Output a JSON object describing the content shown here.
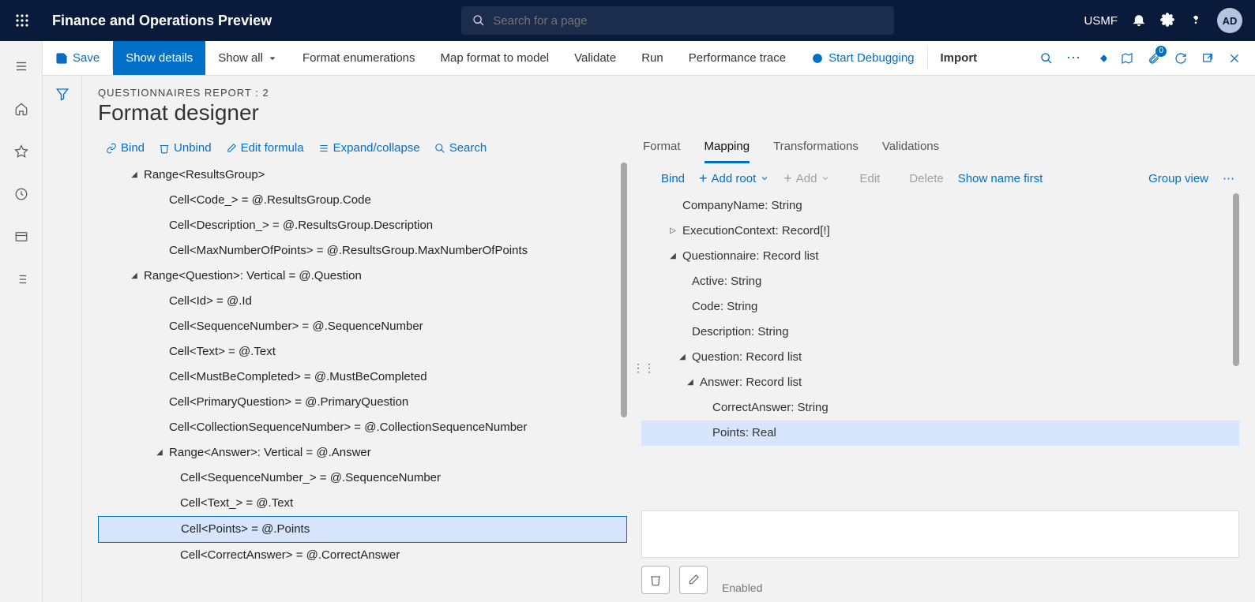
{
  "header": {
    "app_title": "Finance and Operations Preview",
    "search_placeholder": "Search for a page",
    "company": "USMF",
    "avatar": "AD"
  },
  "cmd": {
    "save": "Save",
    "show_details": "Show details",
    "show_all": "Show all",
    "format_enum": "Format enumerations",
    "map_format": "Map format to model",
    "validate": "Validate",
    "run": "Run",
    "perf_trace": "Performance trace",
    "start_debug": "Start Debugging",
    "import": "Import",
    "badge": "0"
  },
  "page": {
    "breadcrumb": "QUESTIONNAIRES REPORT : 2",
    "title": "Format designer"
  },
  "left_toolbar": {
    "bind": "Bind",
    "unbind": "Unbind",
    "edit_formula": "Edit formula",
    "expand": "Expand/collapse",
    "search": "Search"
  },
  "left_tree": [
    {
      "ind": 0,
      "tw": "▾",
      "text": "Range<ResultsGroup>"
    },
    {
      "ind": 1,
      "tw": "",
      "text": "Cell<Code_> = @.ResultsGroup.Code"
    },
    {
      "ind": 1,
      "tw": "",
      "text": "Cell<Description_> = @.ResultsGroup.Description"
    },
    {
      "ind": 1,
      "tw": "",
      "text": "Cell<MaxNumberOfPoints> = @.ResultsGroup.MaxNumberOfPoints"
    },
    {
      "ind": 0,
      "tw": "▾",
      "text": "Range<Question>: Vertical = @.Question"
    },
    {
      "ind": 1,
      "tw": "",
      "text": "Cell<Id> = @.Id"
    },
    {
      "ind": 1,
      "tw": "",
      "text": "Cell<SequenceNumber> = @.SequenceNumber"
    },
    {
      "ind": 1,
      "tw": "",
      "text": "Cell<Text> = @.Text"
    },
    {
      "ind": 1,
      "tw": "",
      "text": "Cell<MustBeCompleted> = @.MustBeCompleted"
    },
    {
      "ind": 1,
      "tw": "",
      "text": "Cell<PrimaryQuestion> = @.PrimaryQuestion"
    },
    {
      "ind": 1,
      "tw": "",
      "text": "Cell<CollectionSequenceNumber> = @.CollectionSequenceNumber"
    },
    {
      "ind": 1,
      "tw": "▾",
      "text": "Range<Answer>: Vertical = @.Answer"
    },
    {
      "ind": 2,
      "tw": "",
      "text": "Cell<SequenceNumber_> = @.SequenceNumber"
    },
    {
      "ind": 2,
      "tw": "",
      "text": "Cell<Text_> = @.Text"
    },
    {
      "ind": 2,
      "tw": "",
      "text": "Cell<Points> = @.Points",
      "selected": true
    },
    {
      "ind": 2,
      "tw": "",
      "text": "Cell<CorrectAnswer> = @.CorrectAnswer"
    }
  ],
  "tabs": {
    "format": "Format",
    "mapping": "Mapping",
    "transformations": "Transformations",
    "validations": "Validations"
  },
  "right_toolbar": {
    "bind": "Bind",
    "add_root": "Add root",
    "add": "Add",
    "edit": "Edit",
    "delete": "Delete",
    "show_name": "Show name first",
    "group_view": "Group view"
  },
  "map_tree": [
    {
      "ind": 0,
      "tw": "",
      "text": "CompanyName: String"
    },
    {
      "ind": 0,
      "tw": "▸",
      "text": "ExecutionContext: Record[!]"
    },
    {
      "ind": 0,
      "tw": "▾",
      "text": "Questionnaire: Record list"
    },
    {
      "ind": 1,
      "tw": "",
      "text": "Active: String"
    },
    {
      "ind": 1,
      "tw": "",
      "text": "Code: String"
    },
    {
      "ind": 1,
      "tw": "",
      "text": "Description: String"
    },
    {
      "ind": 1,
      "tw": "▾",
      "text": "Question: Record list"
    },
    {
      "ind": 2,
      "tw": "▾",
      "text": "Answer: Record list"
    },
    {
      "ind": 3,
      "tw": "",
      "text": "CorrectAnswer: String"
    },
    {
      "ind": 3,
      "tw": "",
      "text": "Points: Real",
      "highlight": true
    }
  ],
  "bottom": {
    "enabled": "Enabled"
  }
}
